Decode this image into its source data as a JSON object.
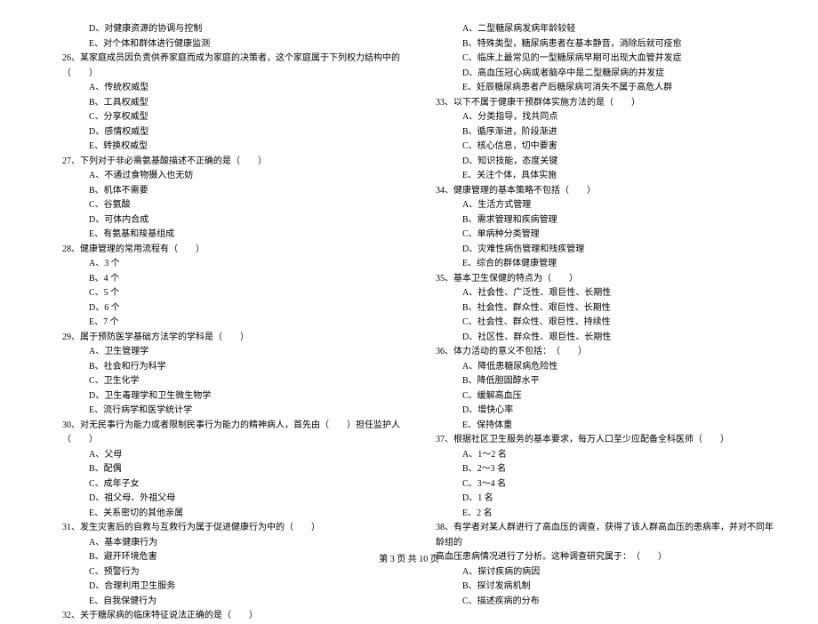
{
  "left": {
    "opt_d1": "D、对健康资源的协调与控制",
    "opt_e1": "E、对个体和群体进行健康监测",
    "q26": "26、某家庭成员因负责供养家庭而成为家庭的决策者，这个家庭属于下列权力结构中的（　　）",
    "q26_a": "A、传统权威型",
    "q26_b": "B、工具权威型",
    "q26_c": "C、分享权威型",
    "q26_d": "D、感情权威型",
    "q26_e": "E、转换权威型",
    "q27": "27、下列对于非必需氨基酸描述不正确的是（　　）",
    "q27_a": "A、不通过食物摄入也无妨",
    "q27_b": "B、机体不需要",
    "q27_c": "C、谷氨酸",
    "q27_d": "D、可体内合成",
    "q27_e": "E、有氨基和羧基组成",
    "q28": "28、健康管理的常用流程有（　　）",
    "q28_a": "A、3 个",
    "q28_b": "B、4 个",
    "q28_c": "C、5 个",
    "q28_d": "D、6 个",
    "q28_e": "E、7 个",
    "q29": "29、属于预防医学基础方法学的学科是（　　）",
    "q29_a": "A、卫生管理学",
    "q29_b": "B、社会和行为科学",
    "q29_c": "C、卫生化学",
    "q29_d": "D、卫生毒理学和卫生微生物学",
    "q29_e": "E、流行病学和医学统计学",
    "q30": "30、对无民事行为能力或者限制民事行为能力的精神病人，首先由（　　）担任监护人（　　）",
    "q30_a": "A、父母",
    "q30_b": "B、配偶",
    "q30_c": "C、成年子女",
    "q30_d": "D、祖父母、外祖父母",
    "q30_e": "E、关系密切的其他亲属",
    "q31": "31、发生灾害后的自救与互救行为属于促进健康行为中的（　　）",
    "q31_a": "A、基本健康行为",
    "q31_b": "B、避开环境危害",
    "q31_c": "C、预警行为",
    "q31_d": "D、合理利用卫生服务",
    "q31_e": "E、自我保健行为",
    "q32": "32、关于糖尿病的临床特征说法正确的是（　　）"
  },
  "right": {
    "q32_a": "A、二型糖尿病发病年龄较轻",
    "q32_b": "B、特殊类型，糖尿病患者在基本静音，消除后就可痊愈",
    "q32_c": "C、临床上最常见的一型糖尿病早期可出现大血管并发症",
    "q32_d": "D、高血压冠心病或者脑卒中是二型糖尿病的并发症",
    "q32_e": "E、妊辰糖尿病患者产后糖尿病可消失不属于高危人群",
    "q33": "33、以下不属于健康干预群体实施方法的是（　　）",
    "q33_a": "A、分类指导，找共同点",
    "q33_b": "B、循序渐进，阶段渐进",
    "q33_c": "C、核心信息，切中要害",
    "q33_d": "D、知识技能，态度关键",
    "q33_e": "E、关注个体，具体实施",
    "q34": "34、健康管理的基本策略不包括（　　）",
    "q34_a": "A、生活方式管理",
    "q34_b": "B、需求管理和疾病管理",
    "q34_c": "C、单病种分类管理",
    "q34_d": "D、灾难性病伤管理和残疾管理",
    "q34_e": "E、综合的群体健康管理",
    "q35": "35、基本卫生保健的特点为（　　）",
    "q35_a": "A、社会性、广泛性、艰巨性、长期性",
    "q35_b": "B、社会性、群众性、艰巨性、长期性",
    "q35_c": "C、社会性、群众性、艰巨性、持续性",
    "q35_d": "D、社区性、群众性、艰巨性、长期性",
    "q36": "36、体力活动的意义不包括：　（　　）",
    "q36_a": "A、降低患糖尿病危险性",
    "q36_b": "B、降低胆固醇水平",
    "q36_c": "C、缓解高血压",
    "q36_d": "D、增快心率",
    "q36_e": "E、保持体重",
    "q37": "37、根据社区卫生服务的基本要求，每万人口至少应配备全科医师（　　）",
    "q37_a": "A、1～2 名",
    "q37_b": "B、2～3 名",
    "q37_c": "C、3～4 名",
    "q37_d": "D、1 名",
    "q37_e": "E、2 名",
    "q38": "38、有学者对某人群进行了高血压的调查，获得了该人群高血压的患病率，并对不同年龄组的",
    "q38_sub": "高血压患病情况进行了分析。这种调查研究属于：　（　　）",
    "q38_a": "A、探讨疾病的病因",
    "q38_b": "B、探讨发病机制",
    "q38_c": "C、描述疾病的分布"
  },
  "footer": "第 3 页 共 10 页"
}
